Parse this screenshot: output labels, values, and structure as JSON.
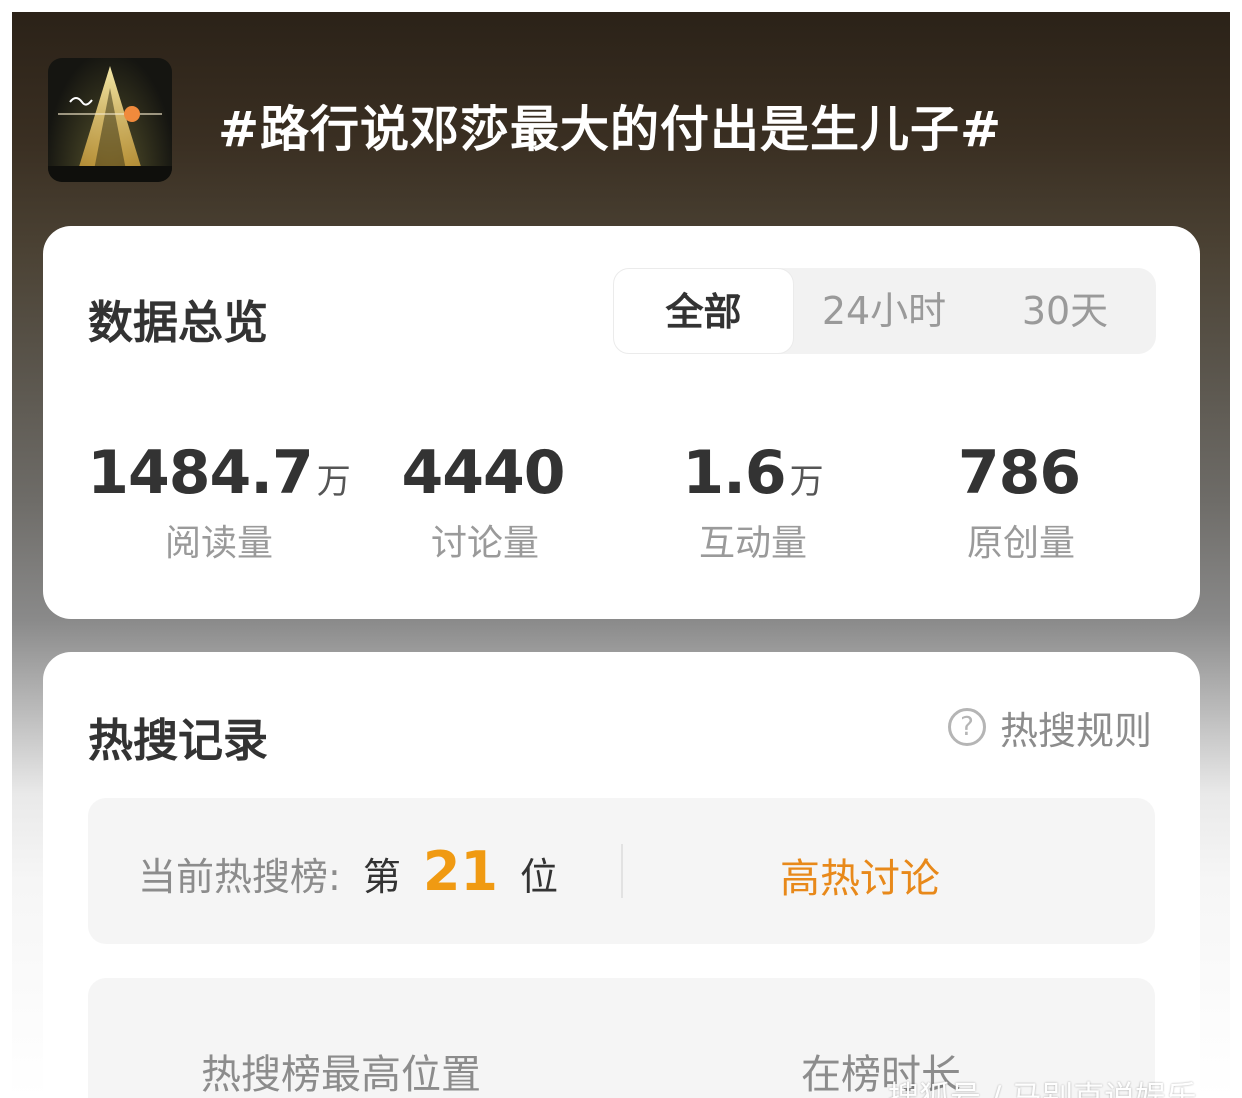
{
  "topic": {
    "title": "#路行说邓莎最大的付出是生儿子#",
    "thumbnail_icon": "topic-cover-image"
  },
  "overview": {
    "title": "数据总览",
    "tabs": [
      {
        "label": "全部",
        "active": true
      },
      {
        "label": "24小时",
        "active": false
      },
      {
        "label": "30天",
        "active": false
      }
    ],
    "stats": [
      {
        "value": "1484.7",
        "unit": "万",
        "label": "阅读量"
      },
      {
        "value": "4440",
        "unit": "",
        "label": "讨论量"
      },
      {
        "value": "1.6",
        "unit": "万",
        "label": "互动量"
      },
      {
        "value": "786",
        "unit": "",
        "label": "原创量"
      }
    ]
  },
  "hot_search": {
    "title": "热搜记录",
    "rules_label": "热搜规则",
    "rules_icon": "question-circle-icon",
    "current_rank": {
      "label": "当前热搜榜",
      "colon": ":",
      "prefix": "第",
      "number": "21",
      "suffix": "位",
      "status": "高热讨论"
    },
    "history": {
      "highest_label": "热搜榜最高位置",
      "duration_label": "在榜时长"
    }
  },
  "watermark": "搜狐号 / 马别克说娱乐",
  "colors": {
    "accent_orange": "#f09a12",
    "status_orange": "#e8891a",
    "text_primary": "#333333",
    "text_secondary": "#9a9a9a"
  }
}
